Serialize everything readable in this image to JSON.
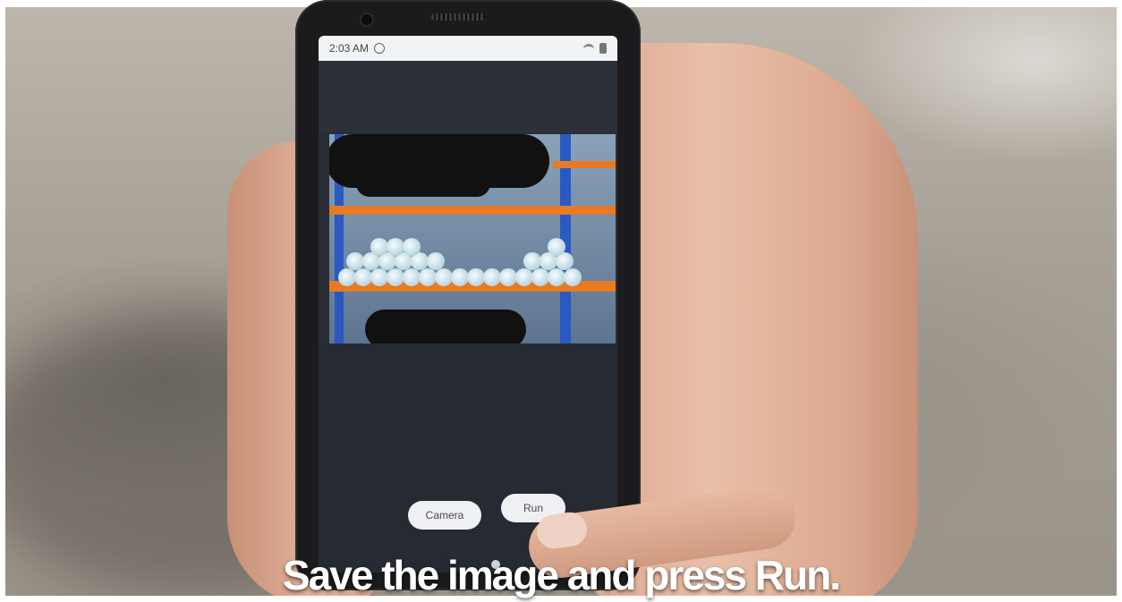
{
  "status_bar": {
    "time": "2:03 AM"
  },
  "buttons": {
    "camera_label": "Camera",
    "run_label": "Run"
  },
  "caption": "Save the image and press Run."
}
